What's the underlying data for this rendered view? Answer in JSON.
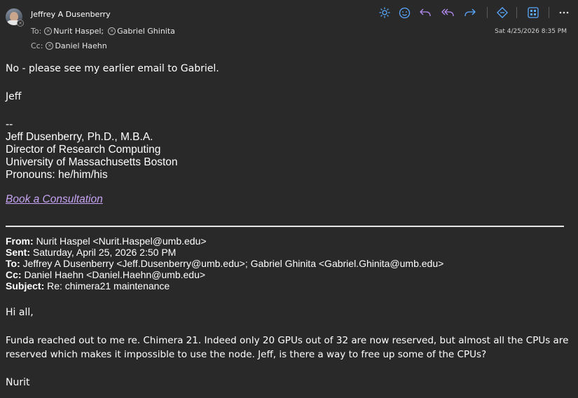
{
  "header": {
    "sender": "Jeffrey A Dusenberry",
    "to_label": "To:",
    "to": [
      "Nurit Haspel;",
      "Gabriel Ghinita"
    ],
    "cc_label": "Cc:",
    "cc": [
      "Daniel Haehn"
    ],
    "date": "Sat 4/25/2026 8:35 PM"
  },
  "toolbar": {
    "icons": [
      "sun-icon",
      "emoji-icon",
      "reply-icon",
      "reply-all-icon",
      "forward-icon",
      "loop-icon",
      "apps-icon",
      "more-icon"
    ]
  },
  "body": {
    "line1": "No - please see my earlier email to Gabriel.",
    "line2": "Jeff",
    "sig_sep": "--",
    "sig_name": "Jeff Dusenberry, Ph.D., M.B.A.",
    "sig_title": "Director of Research Computing",
    "sig_org": "University of Massachusetts Boston",
    "sig_pronouns": "Pronouns: he/him/his",
    "link": "Book a Consultation"
  },
  "forwarded": {
    "from_label": "From:",
    "from": "Nurit Haspel <Nurit.Haspel@umb.edu>",
    "sent_label": "Sent:",
    "sent": "Saturday, April 25, 2026 2:50 PM",
    "to_label": "To:",
    "to": "Jeffrey A Dusenberry <Jeff.Dusenberry@umb.edu>; Gabriel Ghinita <Gabriel.Ghinita@umb.edu>",
    "cc_label": "Cc:",
    "cc": "Daniel Haehn <Daniel.Haehn@umb.edu>",
    "subject_label": "Subject:",
    "subject": "Re: chimera21 maintenance",
    "greeting": "Hi all,",
    "para1": "Funda reached out to me re. Chimera 21. Indeed only 20 GPUs out of 32 are now reserved, but almost all the CPUs are",
    "para2": "reserved which makes it impossible to use the node. Jeff, is there a way to free up some of the CPUs?",
    "signoff": "Nurit"
  }
}
